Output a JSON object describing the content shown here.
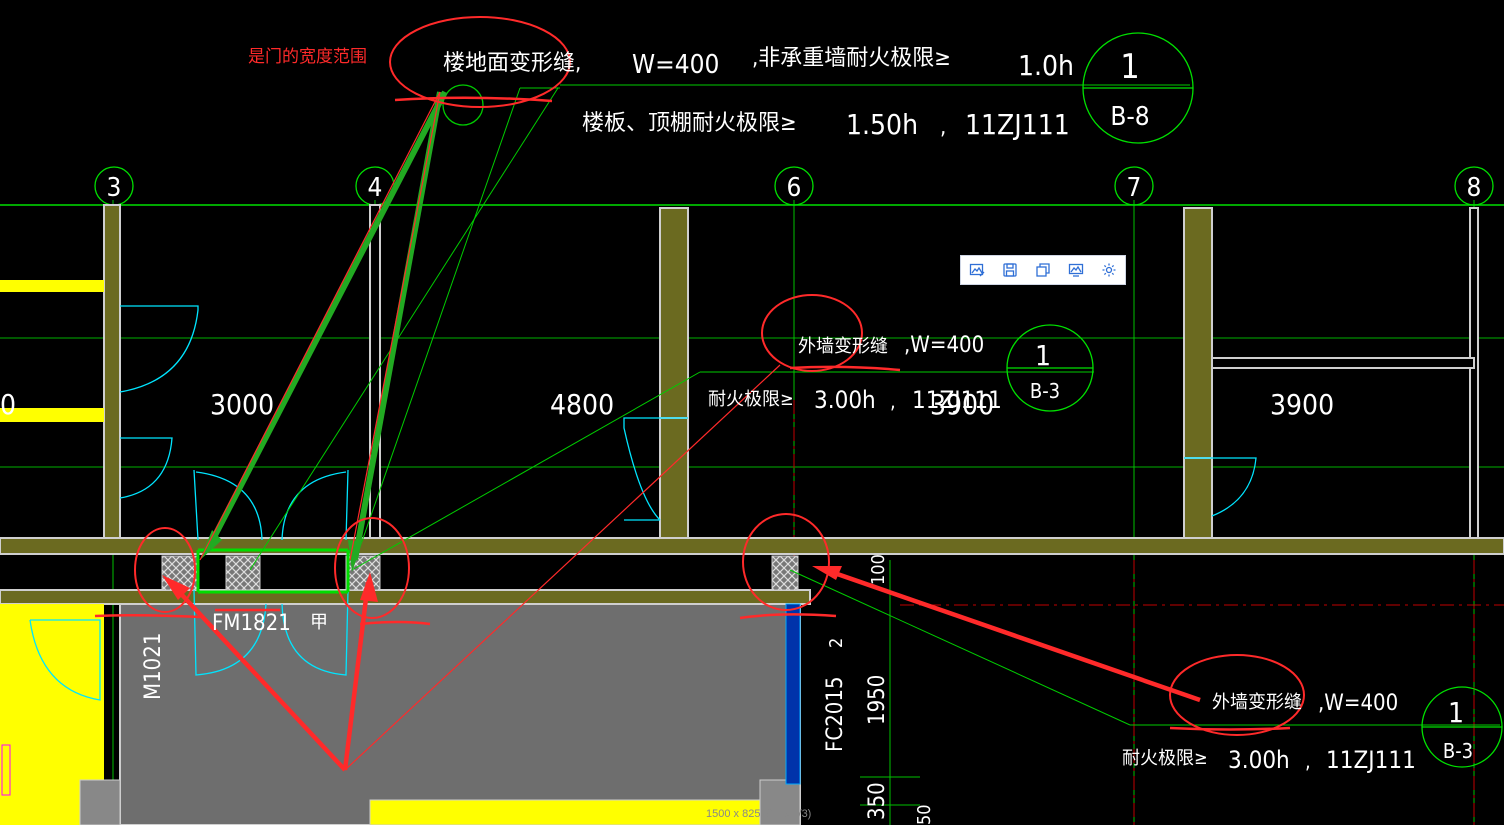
{
  "annotation_note": "是门的宽度范围",
  "detail1": {
    "label": "楼地面变形缝,",
    "width": "W=400",
    "wall_label": ",非承重墙耐火极限≥",
    "wall_value": "1.0h",
    "floor_label": "楼板、顶棚耐火极限≥",
    "floor_value": "1.50h",
    "sep": ",",
    "atlas": "11ZJ111",
    "num": "1",
    "sheet": "B-8"
  },
  "detail2": {
    "label": "外墙变形缝",
    "width": ",W=400",
    "fire_label": "耐火极限≥",
    "fire_value": "3.00h",
    "sep": ",",
    "atlas": "11ZJ111",
    "num": "1",
    "sheet": "B-3"
  },
  "detail3": {
    "label": "外墙变形缝",
    "width": ",W=400",
    "fire_label": "耐火极限≥",
    "fire_value": "3.00h",
    "sep": ",",
    "atlas": "11ZJ111",
    "num": "1",
    "sheet": "B-3"
  },
  "axes": [
    "3",
    "4",
    "6",
    "7",
    "8"
  ],
  "dimensions": {
    "d0": "0",
    "d1": "3000",
    "d2": "4800",
    "d3": "3900",
    "d4": "3900"
  },
  "tags": {
    "door_fm": "FM1821",
    "door_fm_suffix": "甲",
    "door_m": "M1021",
    "window_fc": "FC2015",
    "v_1950": "1950",
    "v_350": "350",
    "v_100": "100",
    "v_2": "2",
    "v_50": "50"
  },
  "toolbar": {
    "items": [
      "image-edit-icon",
      "save-icon",
      "copy-icon",
      "image-view-icon",
      "settings-icon"
    ]
  },
  "status_text": "1500 x 825 @1 x 5/3)",
  "colors": {
    "background": "#000000",
    "axis": "#00ff00",
    "wall_fill": "#6b6a20",
    "wall_edge": "#d0d0d0",
    "annotation": "#ff2a2a",
    "door": "#00e5ff",
    "yellow": "#ffff00",
    "gray_room": "#6e6e6e"
  }
}
